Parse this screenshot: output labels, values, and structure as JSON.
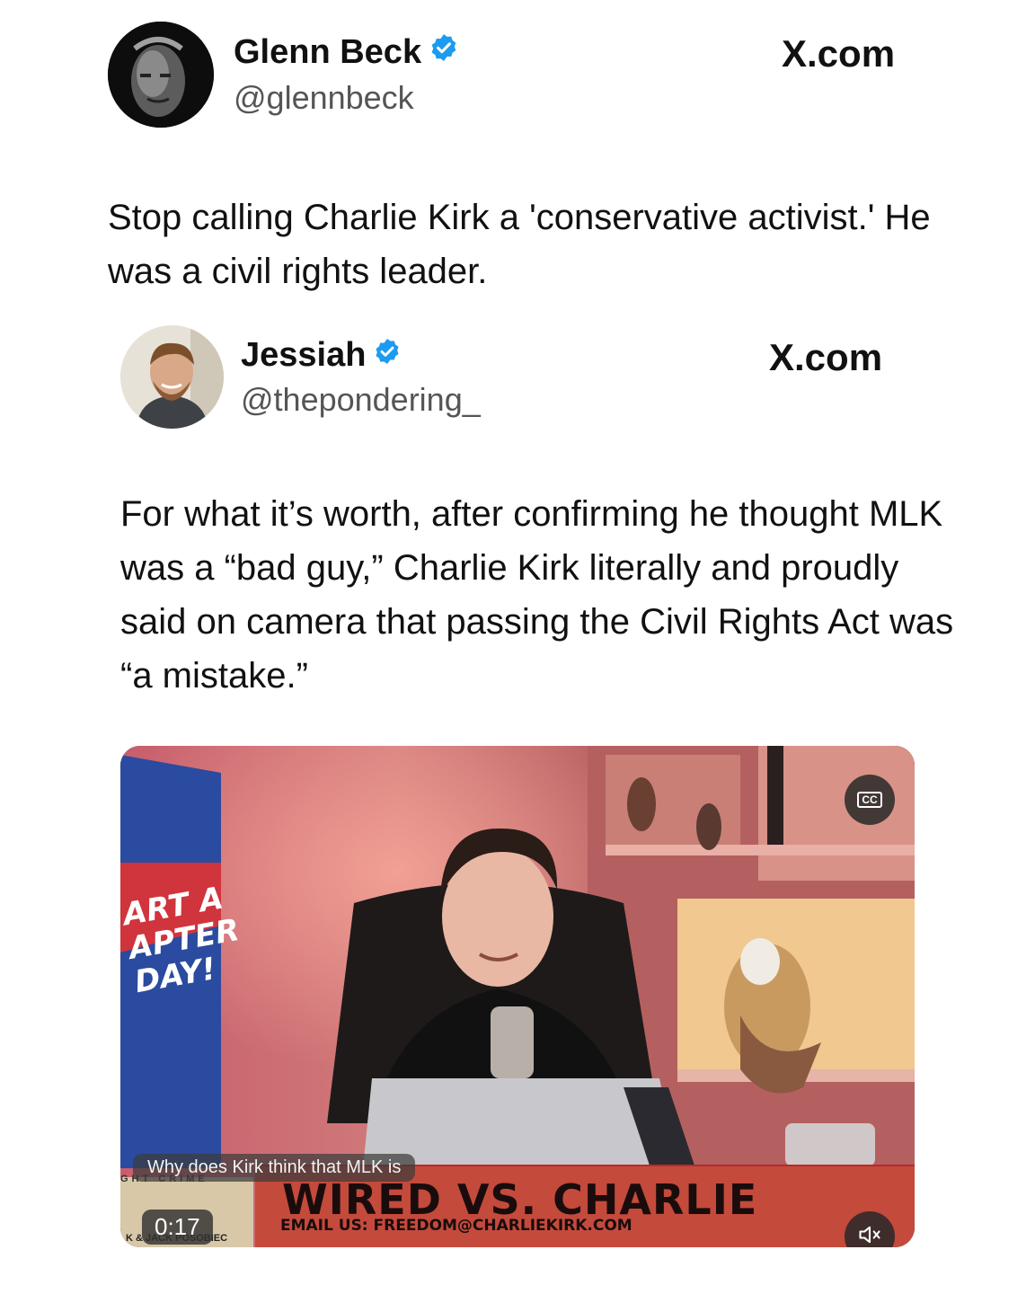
{
  "post1": {
    "name": "Glenn Beck",
    "handle": "@glennbeck",
    "site": "X.com",
    "text": "Stop calling Charlie Kirk a 'conservative activist.' He was a civil rights leader.",
    "avatar_icon": "glenn-beck-avatar"
  },
  "post2": {
    "name": "Jessiah",
    "handle": "@thepondering_",
    "site": "X.com",
    "text": "For what it’s worth, after confirming he thought MLK was a “bad guy,” Charlie Kirk literally and proudly said on camera that passing the Civil Rights Act was “a mistake.”",
    "avatar_icon": "jessiah-avatar"
  },
  "video": {
    "banner_text": "ART A APTER DAY!",
    "cc_label": "CC",
    "caption": "Why does Kirk think that MLK is",
    "time": "0:17",
    "show_title": "WIRED VS. CHARLIE",
    "show_email": "EMAIL US: FREEDOM@CHARLIEKIRK.COM",
    "strip_top": "GHT CRIME",
    "credit": "K & JACK POSOBIEC",
    "mute_icon": "speaker-muted-icon"
  },
  "colors": {
    "verified": "#1d9bf0",
    "lower_third": "#c44a3c",
    "text": "#111111",
    "handle": "#555555"
  }
}
